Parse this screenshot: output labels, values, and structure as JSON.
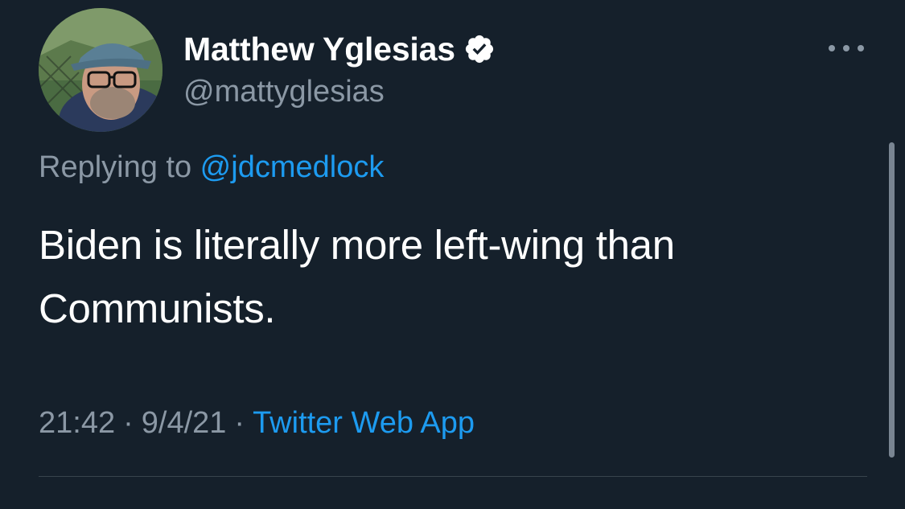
{
  "author": {
    "display_name": "Matthew Yglesias",
    "handle": "@mattyglesias",
    "verified": true,
    "avatar_icon": "profile-photo-avatar",
    "verified_icon": "verified-badge-icon"
  },
  "reply": {
    "prefix": "Replying to",
    "target": "@jdcmedlock"
  },
  "tweet": {
    "text": "Biden is literally more left-wing than Communists."
  },
  "meta": {
    "time": "21:42",
    "date": "9/4/21",
    "separator": "·",
    "source": "Twitter Web App"
  },
  "menu": {
    "icon": "more-options-icon"
  },
  "colors": {
    "background": "#15202b",
    "primary_text": "#ffffff",
    "secondary_text": "#8b98a5",
    "link": "#1d9bf0",
    "divider": "#38444d"
  }
}
